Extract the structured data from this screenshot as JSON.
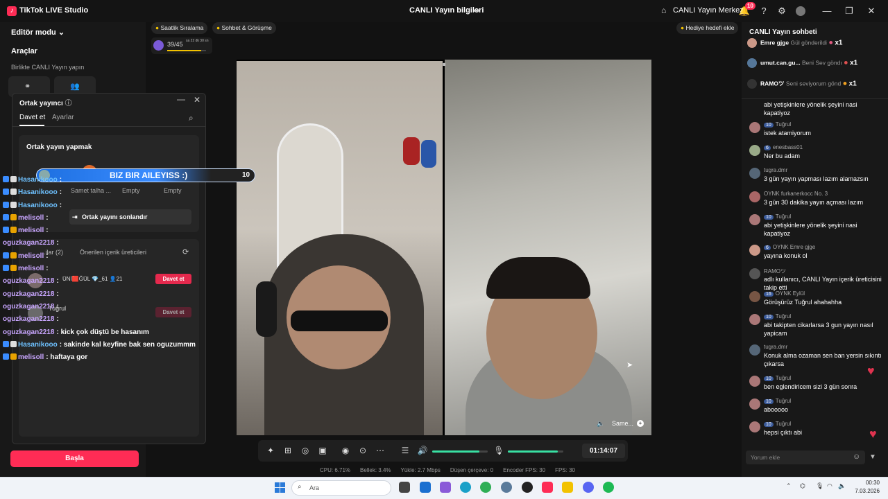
{
  "window": {
    "app_title": "TikTok LIVE Studio",
    "center_title": "CANLI Yayın bilgileri",
    "live_center": "CANLI Yayın Merkezi",
    "notif_count": "10"
  },
  "left": {
    "editor_mode": "Editör modu",
    "tools_title": "Araçlar",
    "cohost_label": "Birlikte CANLI Yayın yapın",
    "start_button": "Başla"
  },
  "modal": {
    "title": "Ortak yayıncı",
    "tab_invite": "Davet et",
    "tab_settings": "Ayarlar",
    "card_title": "Ortak yayın yapmak",
    "slot1": "Samet talha ...",
    "slot2": "Empty",
    "slot3": "Empty",
    "end_cohost": "Ortak yayını sonlandır",
    "suggest_tab1": "...ilar (2)",
    "suggest_tab2": "Önerilen içerik üreticileri",
    "user1": "ÜNİ🟥ĞÜL 💎_61  👤21",
    "invite_button": "Davet et",
    "user2": "Tuğrul",
    "invite_button_2": "Davet et"
  },
  "pills": {
    "ranking": "Saatlik Sıralama",
    "chat_call": "Sohbet & Görüşme",
    "progress": "39/45",
    "progress_sub": "sa 22 dk 30 sn",
    "progress_fraction": 0.867,
    "gift_goal": "Hediye hedefi ekle"
  },
  "banner": {
    "text": "BIZ BIR AILEYISS :)",
    "count": "10"
  },
  "overlay_chat": [
    {
      "name": "Hasanikooo",
      "msg": ":",
      "color": "blue"
    },
    {
      "name": "Hasanikooo",
      "msg": ":",
      "color": "blue"
    },
    {
      "name": "Hasanikooo",
      "msg": ":",
      "color": "blue"
    },
    {
      "name": "melisoll",
      "msg": ":",
      "color": "purple"
    },
    {
      "name": "melisoll",
      "msg": ":",
      "color": "purple"
    },
    {
      "name": "oguzkagan2218",
      "msg": ":",
      "color": "purple"
    },
    {
      "name": "melisoll",
      "msg": ":",
      "color": "purple"
    },
    {
      "name": "melisoll",
      "msg": ":",
      "color": "purple"
    },
    {
      "name": "oguzkagan2218",
      "msg": ":",
      "color": "purple"
    },
    {
      "name": "oguzkagan2218",
      "msg": ":",
      "color": "purple"
    },
    {
      "name": "oguzkagan2218",
      "msg": ":",
      "color": "purple"
    },
    {
      "name": "oguzkagan2218",
      "msg": ":",
      "color": "purple"
    },
    {
      "name": "oguzkagan2218",
      "msg": ": kick çok düştü be hasanım",
      "color": "purple"
    },
    {
      "name": "Hasanikooo",
      "msg": ": sakinde kal keyfine bak sen oguzummm",
      "color": "blue"
    },
    {
      "name": "melisoll",
      "msg": ": haftaya gor",
      "color": "purple"
    }
  ],
  "stream": {
    "cohost_tag": "Same..."
  },
  "controls": {
    "timer": "01:14:07",
    "speaker_level": 0.85,
    "mic_level": 0.9,
    "stats": [
      "CPU: 6.71%",
      "Bellek: 3.4%",
      "Yükle: 2.7 Mbps",
      "Düşen çerçeve: 0",
      "Encoder FPS: 30",
      "FPS: 30"
    ]
  },
  "chat": {
    "title": "CANLI Yayın sohbeti",
    "gifts": [
      {
        "name": "Emre gjge",
        "text": "Gül gönderildi",
        "count": "x1"
      },
      {
        "name": "umut.can.gu...",
        "text": "Beni Sev göndı",
        "count": "x1"
      },
      {
        "name": "RAMOツ",
        "text": "Seni seviyorum gönd",
        "count": "x1"
      }
    ],
    "messages": [
      {
        "user": "",
        "level": "",
        "text": "abi yetişkinlere yönelik şeyini nasi kapatiyoz"
      },
      {
        "user": "Tuğrul",
        "level": "10",
        "text": "istek atamiyorum"
      },
      {
        "user": "enesbass01",
        "level": "6",
        "text": "Ner bu adam"
      },
      {
        "user": "tugra.dmr",
        "level": "",
        "text": "3 gün yayın yapması lazım alamazsın"
      },
      {
        "user": "OYNK furkanerkocc No. 3",
        "level": "",
        "text": "3 gün 30 dakika yayın açması lazım"
      },
      {
        "user": "Tuğrul",
        "level": "10",
        "text": "abi yetişkinlere yönelik şeyini nasi kapatiyoz"
      },
      {
        "user": "OYNK Emre gjge",
        "level": "6",
        "text": "yayına konuk ol"
      },
      {
        "user": "RAMOツ",
        "level": "",
        "text": "adlı kullanıcı, CANLI Yayın içerik üreticisini takip etti"
      },
      {
        "user": "OYNK Eylül",
        "level": "16",
        "text": "Görüşürüz Tuğrul ahahahha"
      },
      {
        "user": "Tuğrul",
        "level": "10",
        "text": "abi takipten cikarlarsa 3 gun yayın nasıl yapicam"
      },
      {
        "user": "tugra.dmr",
        "level": "",
        "text": "Konuk alma ozaman sen ban yersin sıkıntı çıkarsa"
      },
      {
        "user": "Tuğrul",
        "level": "10",
        "text": "ben eglendiricem sizi 3 gün sonra"
      },
      {
        "user": "Tuğrul",
        "level": "10",
        "text": "abooooo"
      },
      {
        "user": "Tuğrul",
        "level": "10",
        "text": "hepsi çıktı abi"
      }
    ],
    "input_placeholder": "Yorum ekle"
  },
  "taskbar": {
    "search": "Ara",
    "time": "00:30",
    "date": "7.03.2026"
  }
}
